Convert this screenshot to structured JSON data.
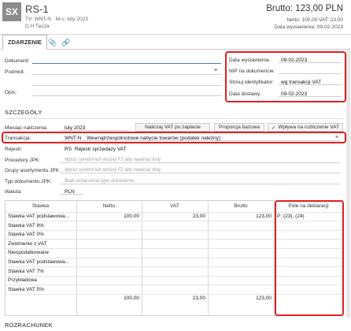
{
  "header": {
    "logo": "SX",
    "title": "RS-1",
    "subtitle": "TV: WNT-N · M-c: luty-2023",
    "counterparty": "D.H Tęcza",
    "brutto_label": "Brutto: 123,00 PLN",
    "netto_line": "Netto: 100,00 VAT: 23,00",
    "data_line": "Data wystawienia: 09-02-2023"
  },
  "tabs": [
    {
      "label": "ZDARZENIE",
      "active": true
    },
    {
      "label": "paperclip-icon"
    },
    {
      "label": "link-icon"
    }
  ],
  "form": {
    "dokument_label": "Dokument:",
    "podmiot_label": "Podmiot:",
    "opis_label": "Opis:",
    "dates": {
      "data_wystawienia_label": "Data wystawienia:",
      "data_wystawienia": "09-02-2023",
      "nip_label": "NIP na dokumencie:",
      "nip": "",
      "stosuj_label": "Stosuj identyfikator:",
      "stosuj": "wg transakcji VAT",
      "data_dostawy_label": "Data dostawy:",
      "data_dostawy": "09-02-2023"
    }
  },
  "szczegoly": {
    "title": "SZCZEGÓŁY",
    "miesiac_label": "Miesiąc naliczenia:",
    "miesiac": "luty 2023",
    "nalicz_vat": "Naliczaj VAT po zapłacie",
    "proporcja": "Proporcja bazowa",
    "wplywa": "Wpływa na rozliczenie VAT",
    "transakcja_label": "Transakcja:",
    "transakcja_code": "WNT-N",
    "transakcja_desc": "Wewnątrzwspólnotowe nabycie towarów (podatek należny)",
    "rejestr_label": "Rejestr:",
    "rejestr_code": "RS",
    "rejestr_desc": "Rejestr sprzedaży VAT",
    "procedury_label": "Procedury JPK:",
    "procedury_ph": "Wpisz symbol lub wciśnij F2 aby nawinąć listę",
    "grupy_label": "Grupy asortymentu JPK:",
    "grupy_ph": "Wpisz symbol lub wciśnij F2 aby nawinąć listę",
    "typ_label": "Typ dokumentu JPK:",
    "typ_ph": "Brak oznaczenia typu dokumentu",
    "waluta_label": "Waluta:",
    "waluta": "PLN"
  },
  "table": {
    "headers": [
      "Stawka",
      "Netto",
      "VAT",
      "Brutto",
      "Pole na deklaracji"
    ],
    "rows": [
      [
        "Stawka VAT podstawowa...",
        "100,00",
        "23,00",
        "123,00",
        "P: (23), (24)"
      ],
      [
        "Stawka VAT 8%",
        "",
        "",
        "",
        ""
      ],
      [
        "Stawka VAT 0%",
        "",
        "",
        "",
        ""
      ],
      [
        "Zwolnienie z VAT",
        "",
        "",
        "",
        ""
      ],
      [
        "Nieopodatkowane",
        "",
        "",
        "",
        ""
      ],
      [
        "Stawka VAT podstawowa...",
        "",
        "",
        "",
        ""
      ],
      [
        "Stawka VAT 7%",
        "",
        "",
        "",
        ""
      ],
      [
        "Przykładowa",
        "",
        "",
        "",
        ""
      ],
      [
        "Stawka VAT 5%",
        "",
        "",
        "",
        ""
      ]
    ],
    "totals": [
      "",
      "100,00",
      "23,00",
      "123,00",
      ""
    ]
  },
  "rozrachunek": {
    "title": "ROZRACHUNEK"
  },
  "colors": {
    "highlight": "#e02020",
    "accent": "#4a7bd0"
  }
}
